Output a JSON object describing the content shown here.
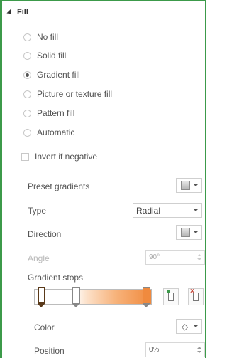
{
  "section": {
    "title": "Fill"
  },
  "fill_options": [
    {
      "label": "No fill",
      "selected": false
    },
    {
      "label": "Solid fill",
      "selected": false
    },
    {
      "label": "Gradient fill",
      "selected": true
    },
    {
      "label": "Picture or texture fill",
      "selected": false
    },
    {
      "label": "Pattern fill",
      "selected": false
    },
    {
      "label": "Automatic",
      "selected": false
    }
  ],
  "invert_if_negative": {
    "label": "Invert if negative",
    "checked": false
  },
  "preset_gradients": {
    "label": "Preset gradients",
    "icon": "gradient-swatch-icon"
  },
  "type": {
    "label": "Type",
    "value": "Radial"
  },
  "direction": {
    "label": "Direction",
    "icon": "direction-swatch-icon"
  },
  "angle": {
    "label": "Angle",
    "value": "90°",
    "disabled": true
  },
  "gradient_stops": {
    "label": "Gradient stops",
    "stops": [
      {
        "position_pct": 0,
        "selected": true
      },
      {
        "position_pct": 33,
        "selected": false
      },
      {
        "position_pct": 100,
        "selected": false
      }
    ],
    "colors": {
      "start": "#ffffff",
      "end": "#f08a3e"
    }
  },
  "color": {
    "label": "Color",
    "icon": "paint-bucket-icon"
  },
  "position": {
    "label": "Position",
    "value": "0%"
  },
  "accent": "#3c9a4a"
}
